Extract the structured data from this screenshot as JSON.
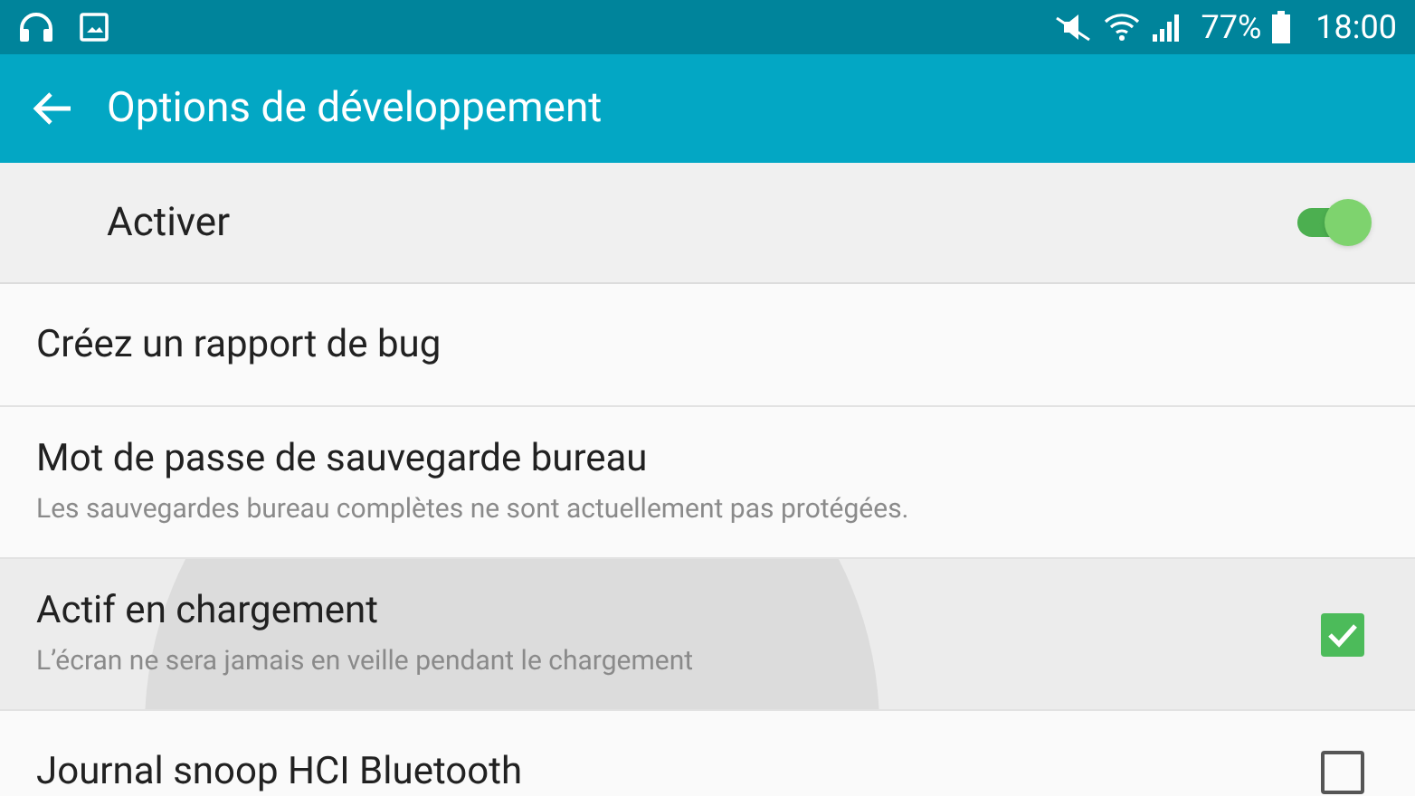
{
  "status_bar": {
    "battery": "77%",
    "time": "18:00"
  },
  "app_bar": {
    "title": "Options de développement"
  },
  "master_switch": {
    "label": "Activer",
    "on": true
  },
  "settings": [
    {
      "kind": "action",
      "title": "Créez un rapport de bug",
      "pressed": false
    },
    {
      "kind": "action",
      "title": "Mot de passe de sauvegarde bureau",
      "summary": "Les sauvegardes bureau complètes ne sont actuellement pas protégées.",
      "pressed": false
    },
    {
      "kind": "checkbox",
      "title": "Actif en chargement",
      "summary": "L’écran ne sera jamais en veille pendant le chargement",
      "checked": true,
      "pressed": true
    },
    {
      "kind": "checkbox",
      "title": "Journal snoop HCI Bluetooth",
      "checked": false,
      "pressed": false
    }
  ]
}
